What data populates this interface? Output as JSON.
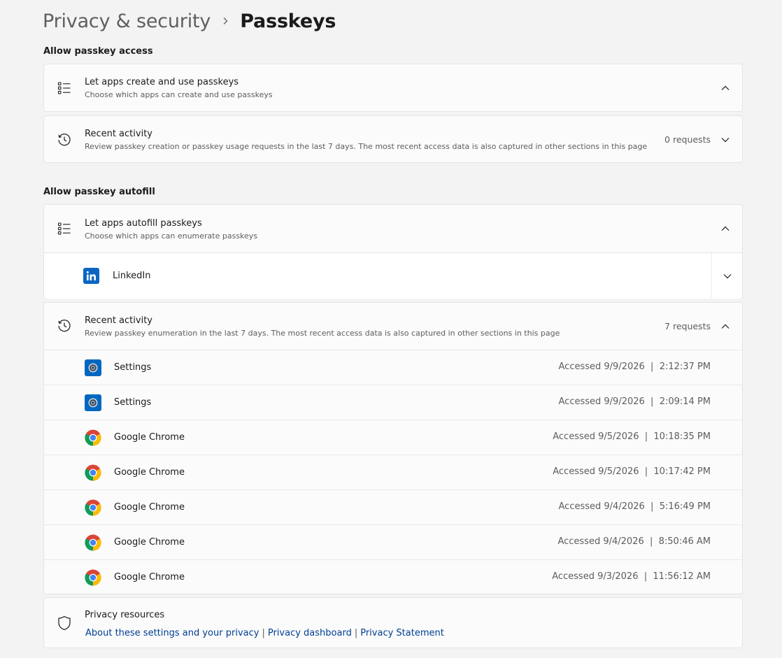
{
  "breadcrumb": {
    "parent": "Privacy & security",
    "separator": "›",
    "current": "Passkeys"
  },
  "sections": {
    "access": {
      "title": "Allow passkey access",
      "create": {
        "title": "Let apps create and use passkeys",
        "desc": "Choose which apps can create and use passkeys"
      },
      "recent": {
        "title": "Recent activity",
        "desc": "Review passkey creation or passkey usage requests in the last 7 days. The most recent access data is also captured in other sections in this page",
        "count": "0 requests"
      }
    },
    "autofill": {
      "title": "Allow passkey autofill",
      "autofill": {
        "title": "Let apps autofill passkeys",
        "desc": "Choose which apps can enumerate passkeys"
      },
      "apps": [
        {
          "name": "LinkedIn",
          "icon": "linkedin-icon"
        }
      ],
      "recent": {
        "title": "Recent activity",
        "desc": "Review passkey enumeration in the last 7 days. The most recent access data is also captured in other sections in this page",
        "count": "7 requests",
        "items": [
          {
            "app": "Settings",
            "icon": "settings-app-icon",
            "accessed": "Accessed 9/9/2026  |  2:12:37 PM"
          },
          {
            "app": "Settings",
            "icon": "settings-app-icon",
            "accessed": "Accessed 9/9/2026  |  2:09:14 PM"
          },
          {
            "app": "Google Chrome",
            "icon": "chrome-icon",
            "accessed": "Accessed 9/5/2026  |  10:18:35 PM"
          },
          {
            "app": "Google Chrome",
            "icon": "chrome-icon",
            "accessed": "Accessed 9/5/2026  |  10:17:42 PM"
          },
          {
            "app": "Google Chrome",
            "icon": "chrome-icon",
            "accessed": "Accessed 9/4/2026  |  5:16:49 PM"
          },
          {
            "app": "Google Chrome",
            "icon": "chrome-icon",
            "accessed": "Accessed 9/4/2026  |  8:50:46 AM"
          },
          {
            "app": "Google Chrome",
            "icon": "chrome-icon",
            "accessed": "Accessed 9/3/2026  |  11:56:12 AM"
          }
        ]
      }
    }
  },
  "privacy": {
    "title": "Privacy resources",
    "links": [
      "About these settings and your privacy",
      "Privacy dashboard",
      "Privacy Statement"
    ]
  },
  "colors": {
    "accent": "#005fb8",
    "link": "#003e92",
    "linkedin": "#0a66c2",
    "settings_blue": "#0067c0"
  }
}
